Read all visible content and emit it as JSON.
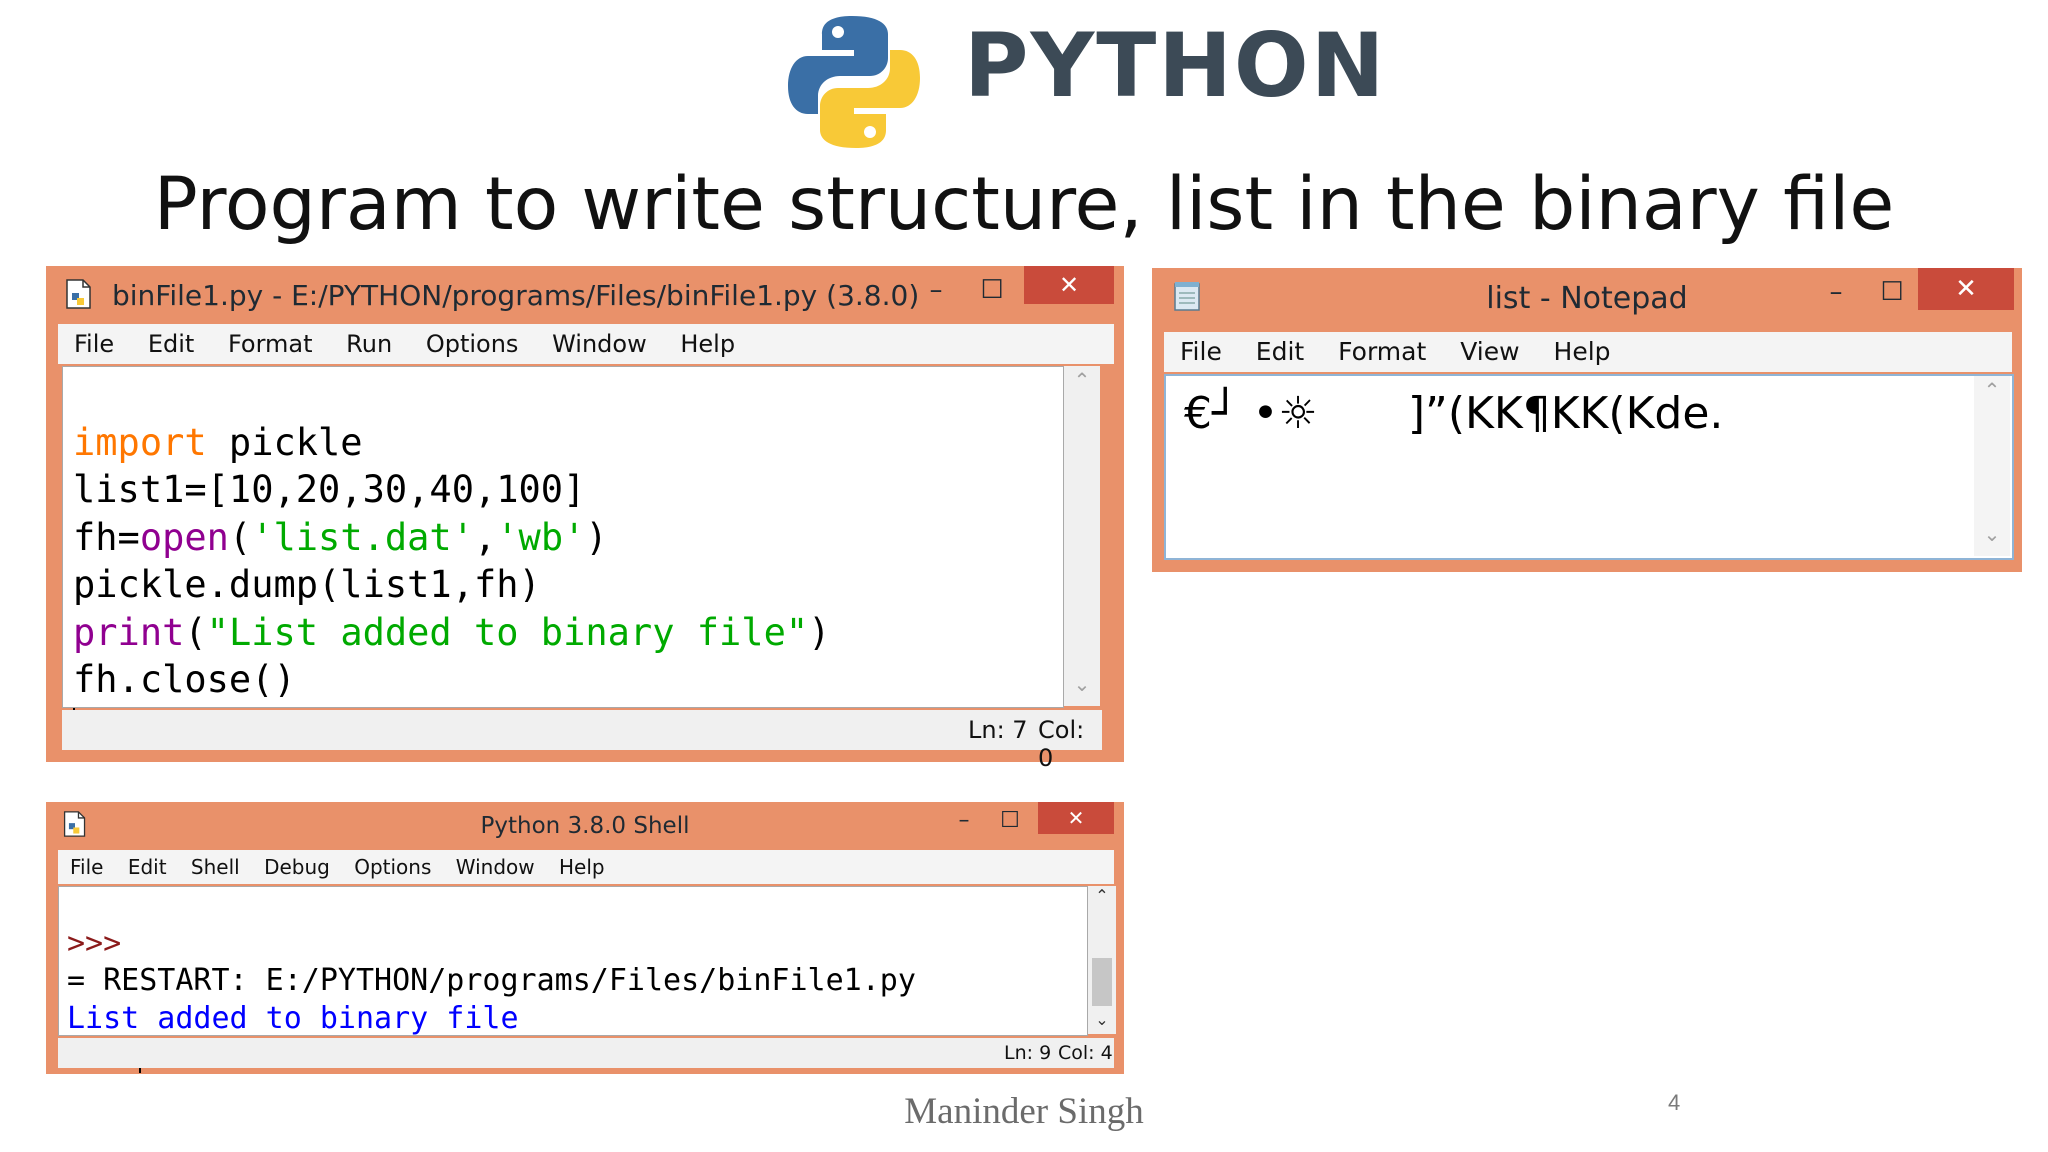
{
  "brand": "PYTHON",
  "slide_title": "Program to write structure, list in the binary file",
  "editor": {
    "title": "binFile1.py - E:/PYTHON/programs/Files/binFile1.py (3.8.0)",
    "menu": [
      "File",
      "Edit",
      "Format",
      "Run",
      "Options",
      "Window",
      "Help"
    ],
    "code": {
      "l1_kw": "import",
      "l1_rest": " pickle",
      "l2": "list1=[10,20,30,40,100]",
      "l3_a": "fh=",
      "l3_open": "open",
      "l3_b": "(",
      "l3_s1": "'list.dat'",
      "l3_c": ",",
      "l3_s2": "'wb'",
      "l3_d": ")",
      "l4": "pickle.dump(list1,fh)",
      "l5_print": "print",
      "l5_a": "(",
      "l5_s": "\"List added to binary file\"",
      "l5_b": ")",
      "l6": "fh.close()"
    },
    "status_ln": "Ln: 7",
    "status_col": "Col: 0"
  },
  "notepad": {
    "title": "list - Notepad",
    "menu": [
      "File",
      "Edit",
      "Format",
      "View",
      "Help"
    ],
    "content_a": "€┘ •☼",
    "content_b": "]”(KK¶KK(Kde."
  },
  "shell": {
    "title": "Python 3.8.0 Shell",
    "menu": [
      "File",
      "Edit",
      "Shell",
      "Debug",
      "Options",
      "Window",
      "Help"
    ],
    "prompt1": ">>>",
    "restart": "= RESTART: E:/PYTHON/programs/Files/binFile1.py",
    "output": "List added to binary file",
    "prompt2": ">>>",
    "status_ln": "Ln: 9",
    "status_col": "Col: 4"
  },
  "controls": {
    "minimize": "–",
    "maximize": "☐",
    "close": "✕"
  },
  "footer": {
    "author": "Maninder Singh",
    "page": "4"
  },
  "colors": {
    "window_frame": "#e9916a",
    "close_button": "#c94b3b",
    "keyword": "#ff7700",
    "builtin": "#900090",
    "string": "#00aa00",
    "output": "#0000ff"
  }
}
